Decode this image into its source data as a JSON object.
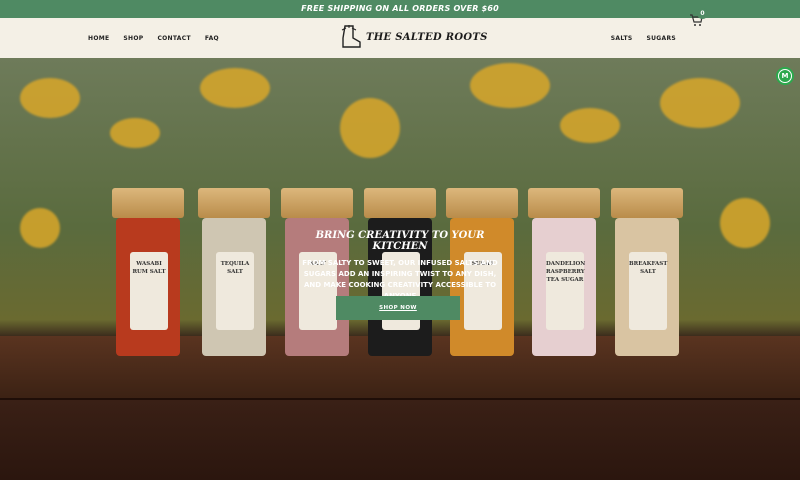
{
  "announcement": "FREE SHIPPING ON ALL ORDERS OVER $60",
  "nav_left": [
    "HOME",
    "SHOP",
    "CONTACT",
    "FAQ"
  ],
  "logo": "THE SALTED ROOTS",
  "nav_right": [
    "SALTS",
    "SUGARS"
  ],
  "cart_count": "0",
  "hero": {
    "title": "BRING CREATIVITY TO YOUR KITCHEN",
    "subtitle": "FROM SALTY TO SWEET, OUR INFUSED SALTS AND SUGARS ADD AN INSPIRING TWIST TO ANY DISH, AND MAKE COOKING CREATIVITY ACCESSIBLE TO ANYONE",
    "button": "SHOP NOW"
  },
  "jars": [
    {
      "label": "WASABI RUM SALT",
      "color": "#b83a1e"
    },
    {
      "label": "TEQUILA SALT",
      "color": "#cfc6b2"
    },
    {
      "label": "SALT",
      "color": "#b57c7c"
    },
    {
      "label": "",
      "color": "#1c1c1c"
    },
    {
      "label": "SUGAR",
      "color": "#d08a2a"
    },
    {
      "label": "DANDELION RASPBERRY TEA SUGAR",
      "color": "#e6cfd0"
    },
    {
      "label": "BREAKFAST SALT",
      "color": "#d9c4a2"
    }
  ],
  "colors": {
    "accent": "#4f8a63",
    "header_bg": "#f4f0e6"
  },
  "icons": {
    "cart": "cart-icon",
    "logo": "boot-logo-icon",
    "badge": "m-badge-icon"
  }
}
